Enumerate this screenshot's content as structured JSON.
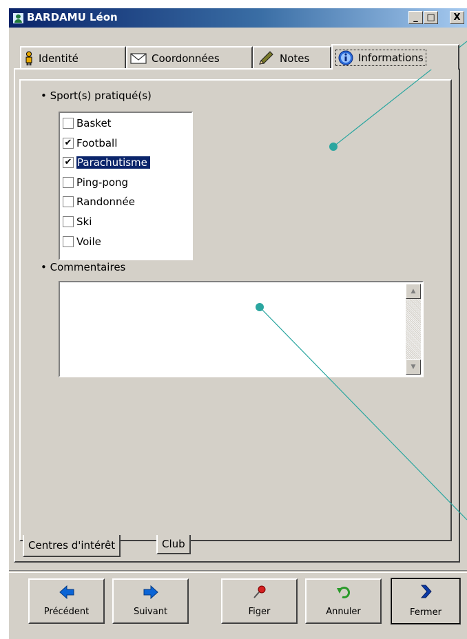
{
  "window": {
    "title": "BARDAMU Léon",
    "controls": {
      "minimize": "_",
      "maximize": "□",
      "close": "X"
    }
  },
  "tabs": [
    {
      "label": "Identité",
      "icon": "person-icon",
      "active": false
    },
    {
      "label": "Coordonnées",
      "icon": "envelope-icon",
      "active": false
    },
    {
      "label": "Notes",
      "icon": "pencil-icon",
      "active": false
    },
    {
      "label": "Informations",
      "icon": "info-icon",
      "active": true
    }
  ],
  "sports": {
    "label": "Sport(s) pratiqué(s)",
    "items": [
      {
        "label": "Basket",
        "checked": false,
        "selected": false
      },
      {
        "label": "Football",
        "checked": true,
        "selected": false
      },
      {
        "label": "Parachutisme",
        "checked": true,
        "selected": true
      },
      {
        "label": "Ping-pong",
        "checked": false,
        "selected": false
      },
      {
        "label": "Randonnée",
        "checked": false,
        "selected": false
      },
      {
        "label": "Ski",
        "checked": false,
        "selected": false
      },
      {
        "label": "Voile",
        "checked": false,
        "selected": false
      }
    ]
  },
  "comments": {
    "label": "Commentaires",
    "value": ""
  },
  "subtabs": [
    {
      "label": "Centres d'intérêt",
      "active": true
    },
    {
      "label": "Club",
      "active": false
    }
  ],
  "buttons": [
    {
      "label": "Précédent",
      "icon": "arrow-left-icon",
      "color": "#0a64d6"
    },
    {
      "label": "Suivant",
      "icon": "arrow-right-icon",
      "color": "#0a64d6"
    },
    {
      "label": "Figer",
      "icon": "pushpin-icon",
      "color": "#d42020"
    },
    {
      "label": "Annuler",
      "icon": "undo-icon",
      "color": "#2a9a2a"
    },
    {
      "label": "Fermer",
      "icon": "chevron-right-icon",
      "color": "#0a3aa8"
    }
  ],
  "colors": {
    "titlebar_start": "#0a246a",
    "titlebar_end": "#a6caf0",
    "face": "#d4d0c8",
    "selection": "#0a246a",
    "annotation": "#2ba6a0"
  }
}
